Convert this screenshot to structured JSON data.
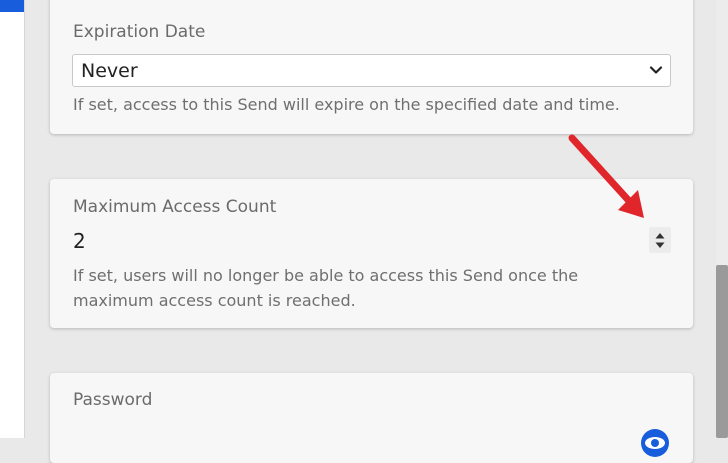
{
  "expiration": {
    "label": "Expiration Date",
    "selected": "Never",
    "hint": "If set, access to this Send will expire on the specified date and time.",
    "chevron_icon": "chevron-down-icon"
  },
  "access_count": {
    "label": "Maximum Access Count",
    "value": "2",
    "hint_line1": "If set, users will no longer be able to access this Send once the",
    "hint_line2": "maximum access count is reached.",
    "spinner_icon": "number-spinner-icon"
  },
  "password": {
    "label": "Password",
    "toggle_icon": "eye-icon"
  },
  "annotation": {
    "arrow_color": "#e0262b",
    "arrow_icon": "red-arrow-icon"
  },
  "colors": {
    "accent": "#175ddc",
    "card_bg": "#f7f7f7",
    "page_bg": "#e9e9e9"
  }
}
